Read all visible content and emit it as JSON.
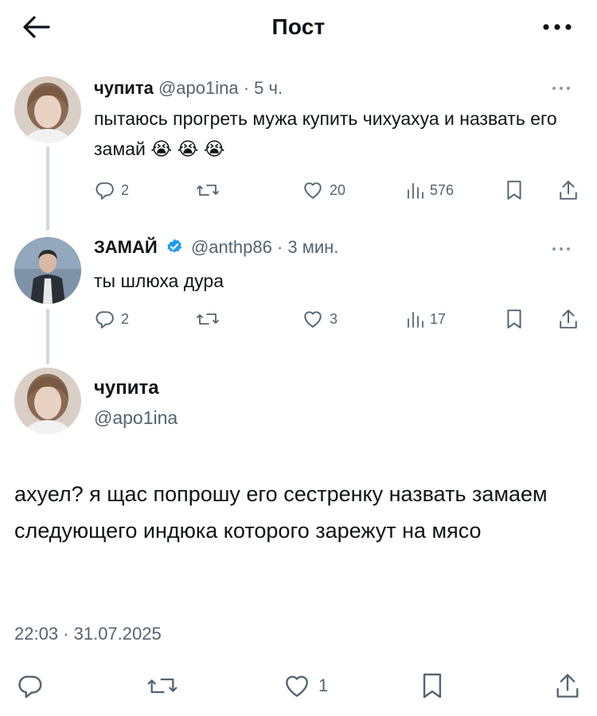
{
  "header": {
    "title": "Пост"
  },
  "thread": [
    {
      "name": "чупита",
      "handle": "@apo1ina",
      "time": "· 5 ч.",
      "text": "пытаюсь прогреть мужа купить чихуахуа и назвать его замай",
      "emoji": "😭 😭 😭",
      "replies": "2",
      "likes": "20",
      "views": "576"
    },
    {
      "name": "ЗАМАЙ",
      "handle": "@anthp86",
      "time": "· 3 мин.",
      "text": "ты шлюха дура",
      "replies": "2",
      "likes": "3",
      "views": "17"
    }
  ],
  "main_post": {
    "name": "чупита",
    "handle": "@apo1ina",
    "text": "ахуел? я щас попрошу его сестренку назвать замаем следующего индюка которого зарежут на мясо",
    "timestamp": "22:03 · 31.07.2025",
    "likes": "1"
  },
  "colors": {
    "text": "#0f1419",
    "secondary": "#536471",
    "verified": "#1d9bf0",
    "thread_line": "#cfd9de"
  }
}
